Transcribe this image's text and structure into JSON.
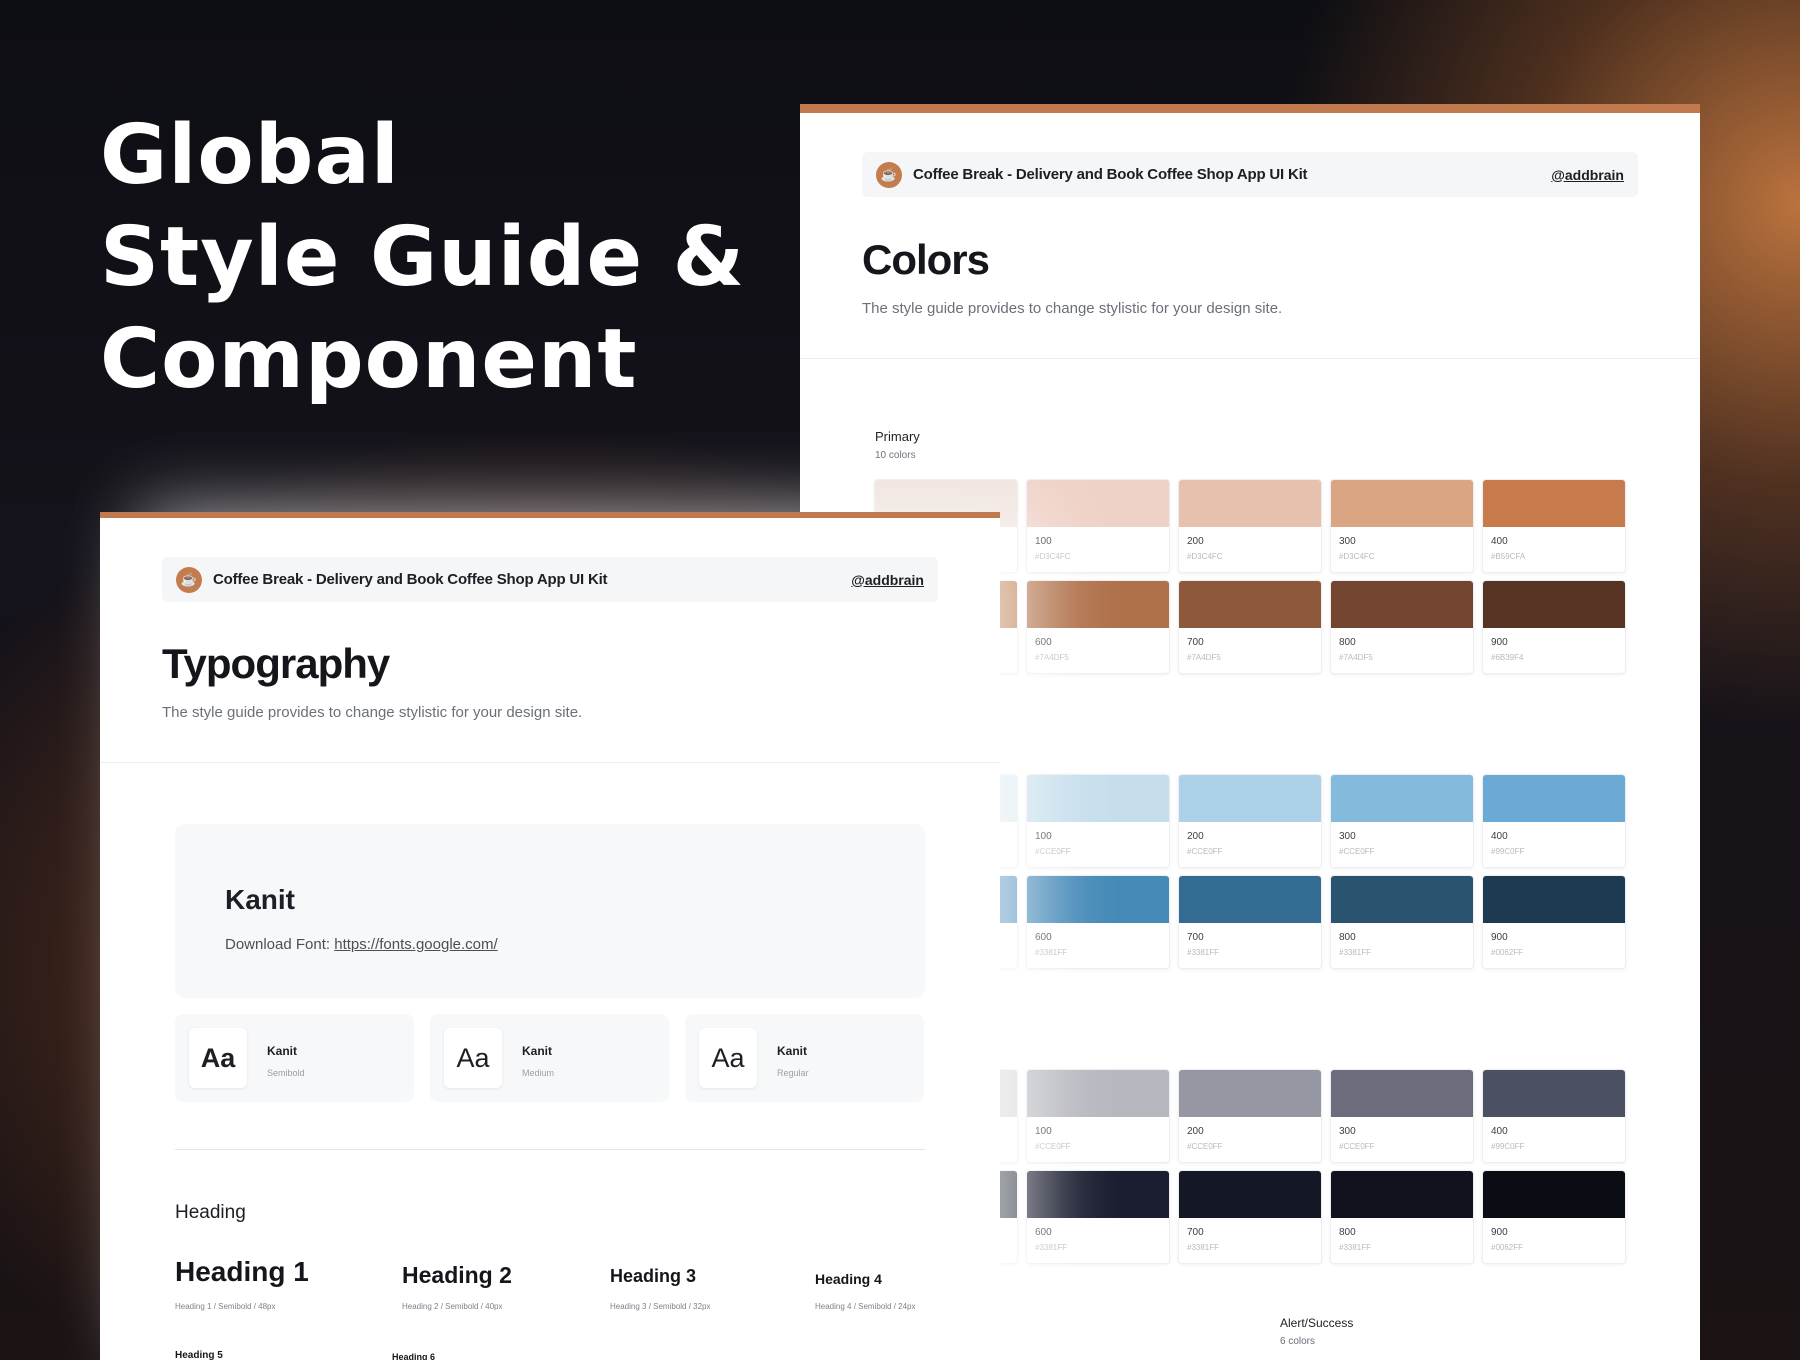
{
  "hero": {
    "line1": "Global",
    "line2": "Style Guide &",
    "line3": "Component"
  },
  "kit": {
    "title": "Coffee Break - Delivery and Book Coffee Shop App UI Kit",
    "handle": "@addbrain",
    "logo_icon": "coffee-cup-icon"
  },
  "colors_page": {
    "title": "Colors",
    "subtitle": "The style guide provides to change stylistic for your design site.",
    "primary": {
      "label": "Primary",
      "count": "10 colors"
    },
    "groups": [
      {
        "row1": [
          {
            "num": "",
            "hex": "",
            "color": "#efe3de"
          },
          {
            "num": "100",
            "hex": "#D3C4FC",
            "color": "#efd2c7"
          },
          {
            "num": "200",
            "hex": "#D3C4FC",
            "color": "#e6c2ae"
          },
          {
            "num": "300",
            "hex": "#D3C4FC",
            "color": "#d9a582"
          },
          {
            "num": "400",
            "hex": "#B59CFA",
            "color": "#c77b4c"
          }
        ],
        "row2": [
          {
            "num": "",
            "hex": "",
            "color": "#b97544"
          },
          {
            "num": "600",
            "hex": "#7A4DF5",
            "color": "#b0714a"
          },
          {
            "num": "700",
            "hex": "#7A4DF5",
            "color": "#8e583a"
          },
          {
            "num": "800",
            "hex": "#7A4DF5",
            "color": "#734530"
          },
          {
            "num": "900",
            "hex": "#6B39F4",
            "color": "#563323"
          }
        ]
      },
      {
        "row1": [
          {
            "num": "",
            "hex": "",
            "color": "#dbe9f1"
          },
          {
            "num": "100",
            "hex": "#CCE0FF",
            "color": "#c6deec"
          },
          {
            "num": "200",
            "hex": "#CCE0FF",
            "color": "#acd0e8"
          },
          {
            "num": "300",
            "hex": "#CCE0FF",
            "color": "#84bbdc"
          },
          {
            "num": "400",
            "hex": "#99C0FF",
            "color": "#6baad5"
          }
        ],
        "row2": [
          {
            "num": "",
            "hex": "",
            "color": "#4d8dbf"
          },
          {
            "num": "600",
            "hex": "#3381FF",
            "color": "#458ab8"
          },
          {
            "num": "700",
            "hex": "#3381FF",
            "color": "#346b93"
          },
          {
            "num": "800",
            "hex": "#3381FF",
            "color": "#29536f"
          },
          {
            "num": "900",
            "hex": "#0062FF",
            "color": "#1e3a50"
          }
        ]
      },
      {
        "row1": [
          {
            "num": "",
            "hex": "",
            "color": "#d4d5d9"
          },
          {
            "num": "100",
            "hex": "#CCE0FF",
            "color": "#b7b8bf"
          },
          {
            "num": "200",
            "hex": "#CCE0FF",
            "color": "#9598a3"
          },
          {
            "num": "300",
            "hex": "#CCE0FF",
            "color": "#6b6d7c"
          },
          {
            "num": "400",
            "hex": "#99C0FF",
            "color": "#4c5063"
          }
        ],
        "row2": [
          {
            "num": "",
            "hex": "",
            "color": "#262a3a"
          },
          {
            "num": "600",
            "hex": "#3381FF",
            "color": "#1a1e30"
          },
          {
            "num": "700",
            "hex": "#3381FF",
            "color": "#141726"
          },
          {
            "num": "800",
            "hex": "#3381FF",
            "color": "#10131d"
          },
          {
            "num": "900",
            "hex": "#0062FF",
            "color": "#0b0d14"
          }
        ]
      }
    ],
    "alert": {
      "label": "Alert/Success",
      "count": "6 colors"
    }
  },
  "typo_page": {
    "title": "Typography",
    "subtitle": "The style guide provides to change stylistic for your design site.",
    "font_name": "Kanit",
    "download_label": "Download Font:",
    "download_link": "https://fonts.google.com/",
    "weights": [
      {
        "aa": "Aa",
        "name": "Kanit",
        "weight": "Semibold"
      },
      {
        "aa": "Aa",
        "name": "Kanit",
        "weight": "Medium"
      },
      {
        "aa": "Aa",
        "name": "Kanit",
        "weight": "Regular"
      }
    ],
    "heading_section": "Heading",
    "headings": [
      {
        "label": "Heading 1",
        "spec": "Heading 1 / Semibold / 48px"
      },
      {
        "label": "Heading 2",
        "spec": "Heading 2 / Semibold / 40px"
      },
      {
        "label": "Heading 3",
        "spec": "Heading 3 / Semibold / 32px"
      },
      {
        "label": "Heading 4",
        "spec": "Heading 4 / Semibold / 24px"
      },
      {
        "label": "Heading 5",
        "spec": ""
      },
      {
        "label": "Heading 6",
        "spec": ""
      }
    ]
  }
}
